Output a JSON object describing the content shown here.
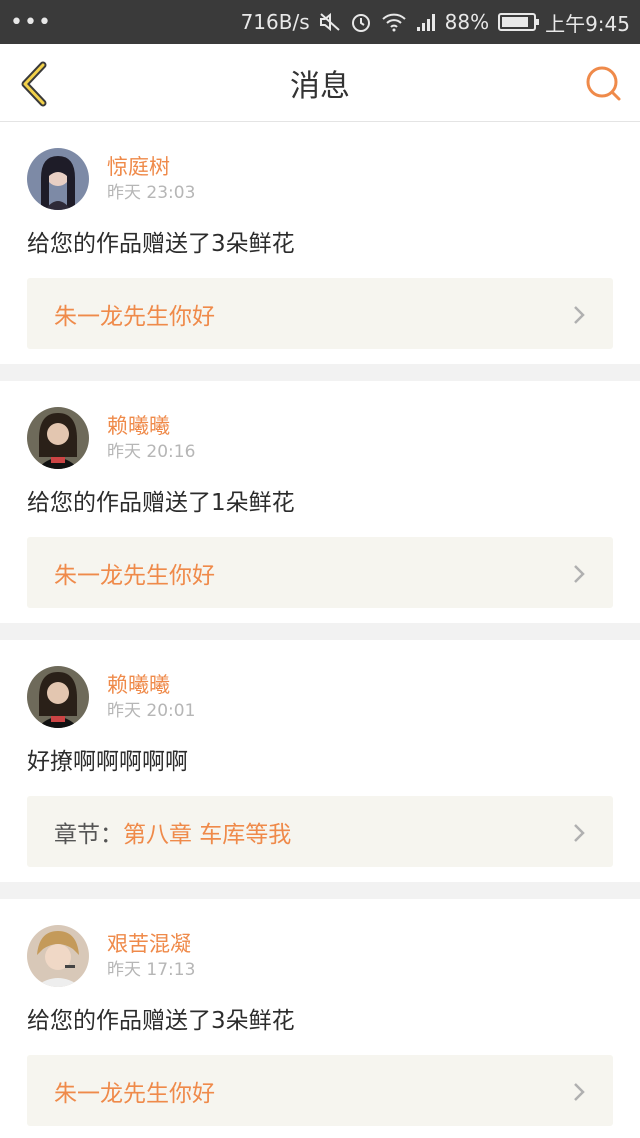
{
  "status_bar": {
    "network_speed": "716B/s",
    "battery": "88%",
    "battery_level": 0.88,
    "time": "上午9:45"
  },
  "nav": {
    "title": "消息"
  },
  "colors": {
    "accent": "#ef8a4a",
    "ref_bg": "#f6f5ef"
  },
  "messages": [
    {
      "user": "惊庭树",
      "time": "昨天 23:03",
      "text": "给您的作品赠送了3朵鲜花",
      "ref_prefix": "",
      "ref_text": "朱一龙先生你好"
    },
    {
      "user": "赖曦曦",
      "time": "昨天 20:16",
      "text": "给您的作品赠送了1朵鲜花",
      "ref_prefix": "",
      "ref_text": "朱一龙先生你好"
    },
    {
      "user": "赖曦曦",
      "time": "昨天 20:01",
      "text": "好撩啊啊啊啊啊",
      "ref_prefix": "章节：",
      "ref_text": "第八章 车库等我"
    },
    {
      "user": "艰苦混凝",
      "time": "昨天 17:13",
      "text": "给您的作品赠送了3朵鲜花",
      "ref_prefix": "",
      "ref_text": "朱一龙先生你好"
    }
  ]
}
